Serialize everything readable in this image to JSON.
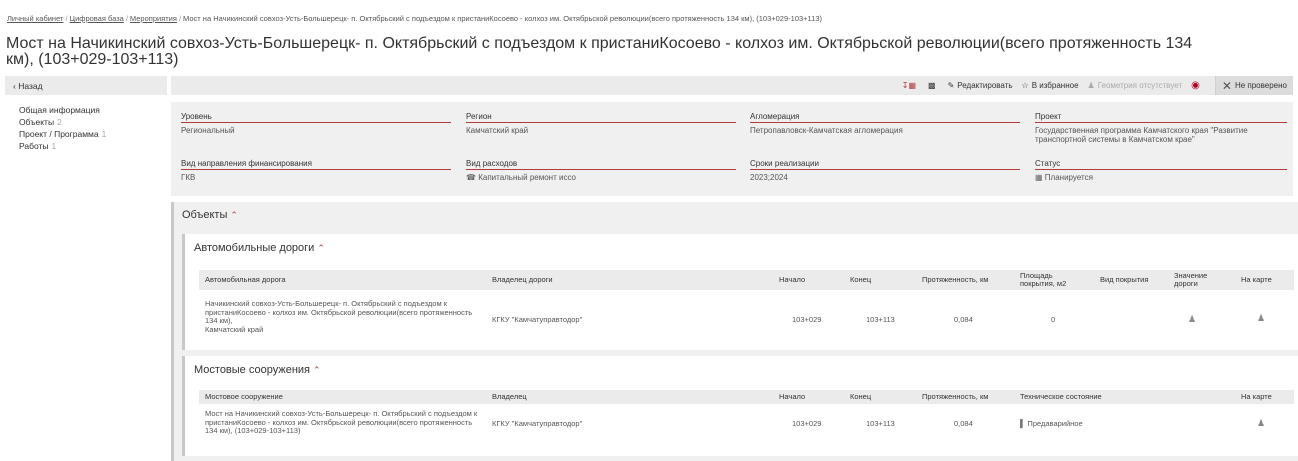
{
  "breadcrumb": {
    "items": [
      "Личный кабинет",
      "Цифровая база",
      "Мероприятия"
    ],
    "current": "Мост на Начикинский совхоз-Усть-Большерецк- п. Октябрьский с подъездом к пристаниКосоево - колхоз им. Октябрьской революции(всего протяженность 134 км), (103+029-103+113)"
  },
  "page": {
    "title": "Мост на Начикинский совхоз-Усть-Большерецк- п. Октябрьский с подъездом к пристаниКосоево - колхоз им. Октябрьской революции(всего протяженность 134 км), (103+029-103+113)"
  },
  "left": {
    "back_label": "Назад",
    "nav": [
      {
        "label": "Общая информация",
        "count": ""
      },
      {
        "label": "Объекты",
        "count": "2"
      },
      {
        "label": "Проект / Программа",
        "count": "1"
      },
      {
        "label": "Работы",
        "count": "1"
      }
    ]
  },
  "toolbar": {
    "edit_label": "Редактировать",
    "favorite_label": "В избранное",
    "geometry_label": "Геометрия отсутствует",
    "status_label": "Не проверено",
    "icons": [
      "export-icon",
      "print-icon",
      "pencil-icon",
      "star-icon",
      "person-pin-icon",
      "target-icon",
      "close-icon"
    ]
  },
  "info": {
    "level_label": "Уровень",
    "level_value": "Региональный",
    "region_label": "Регион",
    "region_value": "Камчатский край",
    "agglomeration_label": "Агломерация",
    "agglomeration_value": "Петропавловск-Камчатская агломерация",
    "project_label": "Проект",
    "project_value": "Государственная программа Камчатского края \"Развитие транспортной системы в Камчатском крае\"",
    "funding_label": "Вид направления финансирования",
    "funding_value": "ГКВ",
    "expense_label": "Вид расходов",
    "expense_value": "Капитальный ремонт иссо",
    "terms_label": "Сроки реализации",
    "terms_value": "2023;2024",
    "status_label": "Статус",
    "status_value": "Планируется"
  },
  "objects": {
    "title": "Объекты",
    "roads": {
      "title": "Автомобильные дороги",
      "columns": [
        "Автомобильная дорога",
        "Владелец дороги",
        "Начало",
        "Конец",
        "Протяженность, км",
        "Площадь покрытия, м2",
        "Вид покрытия",
        "Значение дороги",
        "На карте"
      ],
      "row": {
        "name": "Начикинский совхоз-Усть-Большерецк- п. Октябрьский с подъездом к пристаниКосоево - колхоз им. Октябрьской революции(всего протяженность 134 км),",
        "region": "Камчатский край",
        "owner": "КГКУ \"Камчатуправтодор\"",
        "start": "103+029",
        "end": "103+113",
        "length": "0,084",
        "area": "0",
        "surface": ""
      }
    },
    "bridges": {
      "title": "Мостовые сооружения",
      "columns": [
        "Мостовое сооружение",
        "Владелец",
        "Начало",
        "Конец",
        "Протяженность, км",
        "Техническое состояние",
        "На карте"
      ],
      "row": {
        "name": "Мост на Начикинский совхоз-Усть-Большерецк- п. Октябрьский с подъездом к пристаниКосоево - колхоз им. Октябрьской революции(всего протяженность 134 км), (103+029-103+113)",
        "owner": "КГКУ \"Камчатуправтодор\"",
        "start": "103+029",
        "end": "103+113",
        "length": "0,084",
        "condition": "Предаварийное"
      }
    }
  }
}
